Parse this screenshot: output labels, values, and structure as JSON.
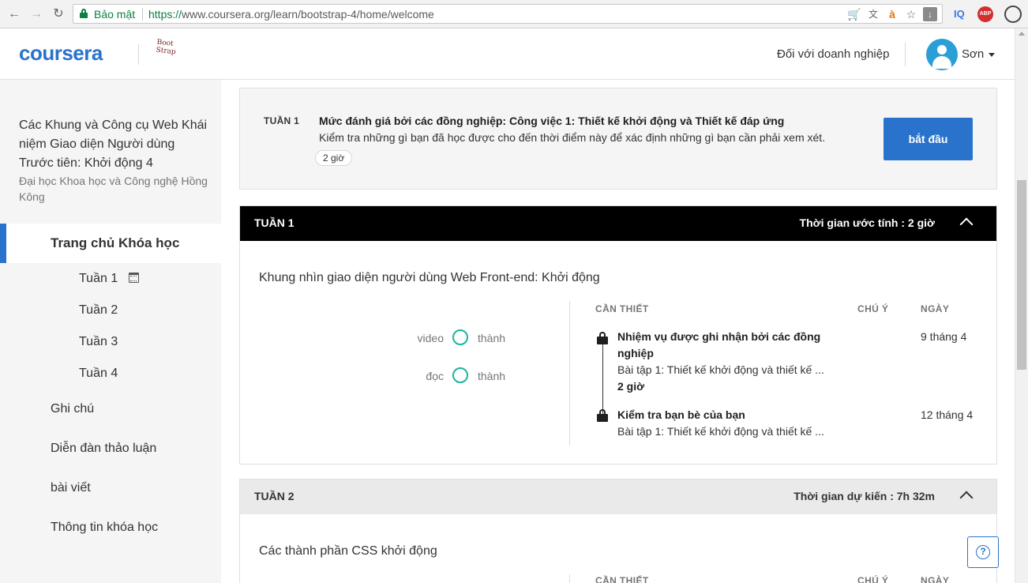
{
  "browser": {
    "secure_label": "Bảo mật",
    "url_scheme": "https://",
    "url_rest": "www.coursera.org/learn/bootstrap-4/home/welcome",
    "ext_iq": "IQ",
    "ext_abp": "ABP",
    "icons": [
      "back-arrow-icon",
      "forward-arrow-icon",
      "reload-icon",
      "lock-icon",
      "cart-icon",
      "translate-icon",
      "accent-icon",
      "star-icon",
      "download-icon",
      "profile-circle-icon"
    ]
  },
  "header": {
    "logo": "coursera",
    "partner_logo": "Boot Strap",
    "business_link": "Đối với doanh nghiệp",
    "user_name": "Sơn"
  },
  "sidebar": {
    "course_title": "Các Khung và Công cụ Web Khái niệm Giao diện Người dùng Trước tiên: Khởi động 4",
    "university": "Đại học Khoa học và Công nghệ Hồng Kông",
    "active_item": "Trang chủ Khóa học",
    "weeks": [
      "Tuần 1",
      "Tuần 2",
      "Tuần 3",
      "Tuần 4"
    ],
    "items": [
      "Ghi chú",
      "Diễn đàn thảo luận",
      "bài viết",
      "Thông tin khóa học"
    ]
  },
  "assessment": {
    "week_label": "TUẦN 1",
    "title": "Mức đánh giá bởi các đồng nghiệp: Công việc 1: Thiết kế khởi động và Thiết kế đáp ứng",
    "description": "Kiểm tra những gì bạn đã học được cho đến thời điểm này để xác định những gì bạn cần phải xem xét.",
    "duration": "2 giờ",
    "start_button": "bắt đầu"
  },
  "week1": {
    "title": "TUẦN 1",
    "estimate": "Thời gian ước tính : 2 giờ",
    "module_title": "Khung nhìn giao diện người dùng Web Front-end: Khởi động",
    "stats": [
      {
        "label": "video",
        "status": "thành"
      },
      {
        "label": "đọc",
        "status": "thành"
      }
    ],
    "columns": {
      "required": "CẦN THIẾT",
      "note": "CHÚ Ý",
      "date": "NGÀY"
    },
    "items": [
      {
        "title": "Nhiệm vụ được ghi nhận bởi các đồng nghiệp",
        "subtitle": "Bài tập 1: Thiết kế khởi động và thiết kế ...",
        "hours": "2 giờ",
        "date": "9 tháng 4"
      },
      {
        "title": "Kiểm tra bạn bè của bạn",
        "subtitle": "Bài tập 1: Thiết kế khởi động và thiết kế ...",
        "date": "12 tháng 4"
      }
    ]
  },
  "week2": {
    "title": "TUẦN 2",
    "estimate": "Thời gian dự kiến : 7h 32m",
    "module_title": "Các thành phần CSS khởi động",
    "columns": {
      "required": "CẦN THIẾT",
      "note": "CHÚ Ý",
      "date": "NGÀY"
    }
  },
  "help": {
    "symbol": "?"
  }
}
